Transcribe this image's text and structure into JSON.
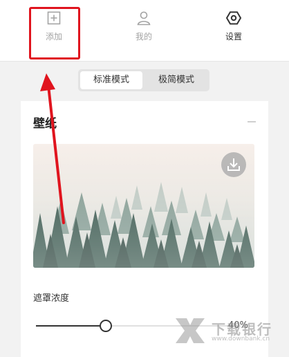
{
  "topnav": {
    "add_label": "添加",
    "mine_label": "我的",
    "settings_label": "设置"
  },
  "mode_switch": {
    "standard_label": "标准模式",
    "simple_label": "极简模式",
    "selected": "标准模式"
  },
  "wallpaper_section": {
    "title": "壁纸",
    "image_desc_icon": "download-icon"
  },
  "opacity": {
    "label": "遮罩浓度",
    "value_fraction": 0.36,
    "value_text": "40%"
  },
  "watermark": {
    "name": "下载银行",
    "url": "www.downbank.cn"
  },
  "colors": {
    "highlight": "#e0141e",
    "active_nav": "#333333",
    "inactive_nav": "#a3a3a3"
  }
}
